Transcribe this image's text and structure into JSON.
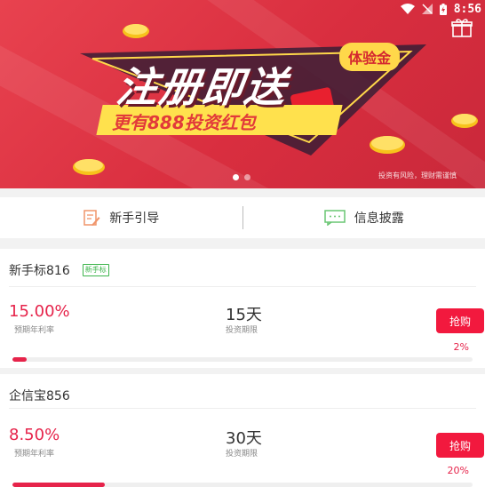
{
  "status": {
    "time": "8:56"
  },
  "banner": {
    "headline": "注册即送",
    "gold_badge": "体验金",
    "ribbon": "更有888投资红包",
    "disclaimer": "投资有风险，理财需谨慎",
    "slide_count": 2,
    "active_slide": 0
  },
  "nav": {
    "guide_label": "新手引导",
    "disclosure_label": "信息披露"
  },
  "products": [
    {
      "name": "新手标816",
      "tag": "新手标",
      "rate": "15.00%",
      "rate_label": "预期年利率",
      "term": "15天",
      "term_label": "投资期限",
      "buy_label": "抢购",
      "progress_label": "2%",
      "progress": 0.02
    },
    {
      "name": "企信宝856",
      "tag": "",
      "rate": "8.50%",
      "rate_label": "预期年利率",
      "term": "30天",
      "term_label": "投资期限",
      "buy_label": "抢购",
      "progress_label": "20%",
      "progress": 0.2
    }
  ],
  "colors": {
    "accent": "#e6234a",
    "button": "#f2193e",
    "banner": "#d92e3f",
    "tag_green": "#3cb44b"
  }
}
